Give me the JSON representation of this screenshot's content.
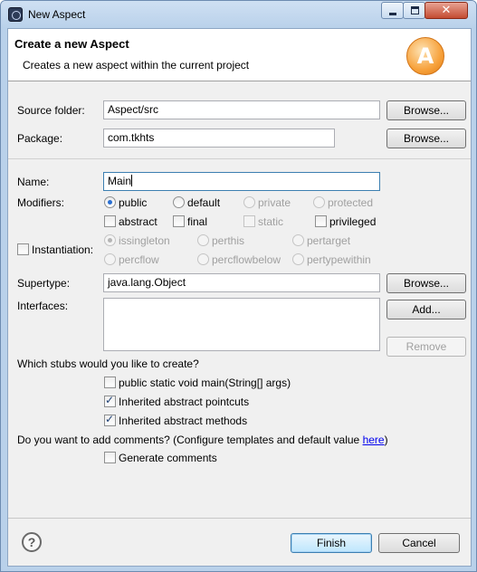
{
  "window": {
    "title": "New Aspect",
    "icon": "eclipse-app-icon",
    "controls": {
      "minimize": "minimize-icon",
      "maximize": "maximize-icon",
      "close": "✕"
    }
  },
  "banner": {
    "title": "Create a new Aspect",
    "description": "Creates a new aspect within the current project",
    "logo_letter": "A"
  },
  "source_folder": {
    "label": "Source folder:",
    "value": "Aspect/src",
    "browse": "Browse..."
  },
  "package": {
    "label": "Package:",
    "value": "com.tkhts",
    "browse": "Browse..."
  },
  "name": {
    "label": "Name:",
    "value": "Main"
  },
  "modifiers": {
    "label": "Modifiers:",
    "access": [
      {
        "label": "public",
        "selected": true,
        "enabled": true
      },
      {
        "label": "default",
        "selected": false,
        "enabled": true
      },
      {
        "label": "private",
        "selected": false,
        "enabled": false
      },
      {
        "label": "protected",
        "selected": false,
        "enabled": false
      }
    ],
    "flags": [
      {
        "label": "abstract",
        "checked": false,
        "enabled": true
      },
      {
        "label": "final",
        "checked": false,
        "enabled": true
      },
      {
        "label": "static",
        "checked": false,
        "enabled": false
      },
      {
        "label": "privileged",
        "checked": false,
        "enabled": true
      }
    ]
  },
  "instantiation": {
    "label": "Instantiation:",
    "checked": false,
    "options": [
      {
        "label": "issingleton",
        "selected": true
      },
      {
        "label": "perthis",
        "selected": false
      },
      {
        "label": "pertarget",
        "selected": false
      },
      {
        "label": "percflow",
        "selected": false
      },
      {
        "label": "percflowbelow",
        "selected": false
      },
      {
        "label": "pertypewithin",
        "selected": false
      }
    ]
  },
  "supertype": {
    "label": "Supertype:",
    "value": "java.lang.Object",
    "browse": "Browse..."
  },
  "interfaces": {
    "label": "Interfaces:",
    "add": "Add...",
    "remove": "Remove"
  },
  "stubs": {
    "question": "Which stubs would you like to create?",
    "items": [
      {
        "label": "public static void main(String[] args)",
        "checked": false
      },
      {
        "label": "Inherited abstract pointcuts",
        "checked": true
      },
      {
        "label": "Inherited abstract methods",
        "checked": true
      }
    ]
  },
  "comments": {
    "question_prefix": "Do you want to add comments? (Configure templates and default value ",
    "link": "here",
    "question_suffix": ")",
    "generate_label": "Generate comments",
    "generate_checked": false
  },
  "footer": {
    "help": "?",
    "finish": "Finish",
    "cancel": "Cancel"
  }
}
